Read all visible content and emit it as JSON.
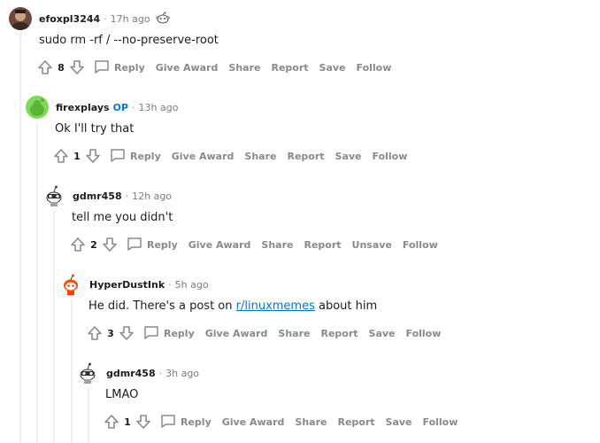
{
  "comments": [
    {
      "username": "efoxpl3244",
      "time": "17h ago",
      "body": "sudo rm -rf / --no-preserve-root",
      "score": "8",
      "actions": {
        "reply": "Reply",
        "award": "Give Award",
        "share": "Share",
        "report": "Report",
        "save": "Save",
        "follow": "Follow"
      }
    },
    {
      "username": "firexplays",
      "op_badge": "OP",
      "time": "13h ago",
      "body": "Ok I'll try that",
      "score": "1",
      "actions": {
        "reply": "Reply",
        "award": "Give Award",
        "share": "Share",
        "report": "Report",
        "save": "Save",
        "follow": "Follow"
      }
    },
    {
      "username": "gdmr458",
      "time": "12h ago",
      "body": "tell me you didn't",
      "score": "2",
      "actions": {
        "reply": "Reply",
        "award": "Give Award",
        "share": "Share",
        "report": "Report",
        "save": "Unsave",
        "follow": "Follow"
      }
    },
    {
      "username": "HyperDustInk",
      "time": "5h ago",
      "body_before": "He did. There's a post on ",
      "body_link": "r/linuxmemes",
      "body_after": " about him",
      "score": "3",
      "actions": {
        "reply": "Reply",
        "award": "Give Award",
        "share": "Share",
        "report": "Report",
        "save": "Save",
        "follow": "Follow"
      }
    },
    {
      "username": "gdmr458",
      "time": "3h ago",
      "body": "LMAO",
      "score": "1",
      "actions": {
        "reply": "Reply",
        "award": "Give Award",
        "share": "Share",
        "report": "Report",
        "save": "Save",
        "follow": "Follow"
      }
    }
  ],
  "icons": {
    "upvote": "upvote-arrow-icon",
    "downvote": "downvote-arrow-icon",
    "reply": "speech-bubble-icon",
    "award": "snoo-award-icon"
  },
  "colors": {
    "link": "#0079d3",
    "op": "#0079d3",
    "meta": "#878a8c",
    "thread_line": "#edeff1"
  }
}
